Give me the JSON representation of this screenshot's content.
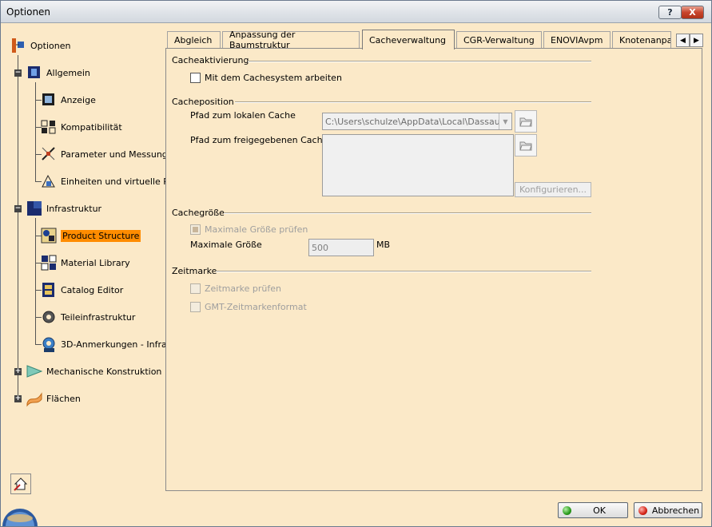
{
  "window": {
    "title": "Optionen",
    "help_label": "?",
    "close_label": "X"
  },
  "tree": {
    "root": "Optionen",
    "items": [
      {
        "label": "Allgemein"
      },
      {
        "label": "Anzeige"
      },
      {
        "label": "Kompatibilität"
      },
      {
        "label": "Parameter und Messung"
      },
      {
        "label": "Einheiten und virtuelle R"
      },
      {
        "label": "Infrastruktur"
      },
      {
        "label": "Product Structure"
      },
      {
        "label": "Material Library"
      },
      {
        "label": "Catalog Editor"
      },
      {
        "label": "Teileinfrastruktur"
      },
      {
        "label": "3D-Anmerkungen - Infra"
      },
      {
        "label": "Mechanische Konstruktion"
      },
      {
        "label": "Flächen"
      }
    ]
  },
  "tabs": [
    {
      "label": "Abgleich"
    },
    {
      "label": "Anpassung der Baumstruktur"
    },
    {
      "label": "Cacheverwaltung"
    },
    {
      "label": "CGR-Verwaltung"
    },
    {
      "label": "ENOVIAvpm"
    },
    {
      "label": "Knotenanpas"
    }
  ],
  "tab_scroll": {
    "left": "◀",
    "right": "▶"
  },
  "panel": {
    "cacheaktivierung": {
      "title": "Cacheaktivierung",
      "checkbox_label": "Mit dem Cachesystem arbeiten"
    },
    "cacheposition": {
      "title": "Cacheposition",
      "local_label": "Pfad zum lokalen Cache",
      "local_value": "C:\\Users\\schulze\\AppData\\Local\\Dassault",
      "shared_label": "Pfad zum freigegebenen Cache",
      "configure_label": "Konfigurieren..."
    },
    "cachegroesse": {
      "title": "Cachegröße",
      "check_label": "Maximale Größe prüfen",
      "max_label": "Maximale Größe",
      "max_value": "500",
      "unit": "MB"
    },
    "zeitmarke": {
      "title": "Zeitmarke",
      "check_label": "Zeitmarke prüfen",
      "gmt_label": "GMT-Zeitmarkenformat"
    }
  },
  "buttons": {
    "ok": "OK",
    "cancel": "Abbrechen"
  }
}
